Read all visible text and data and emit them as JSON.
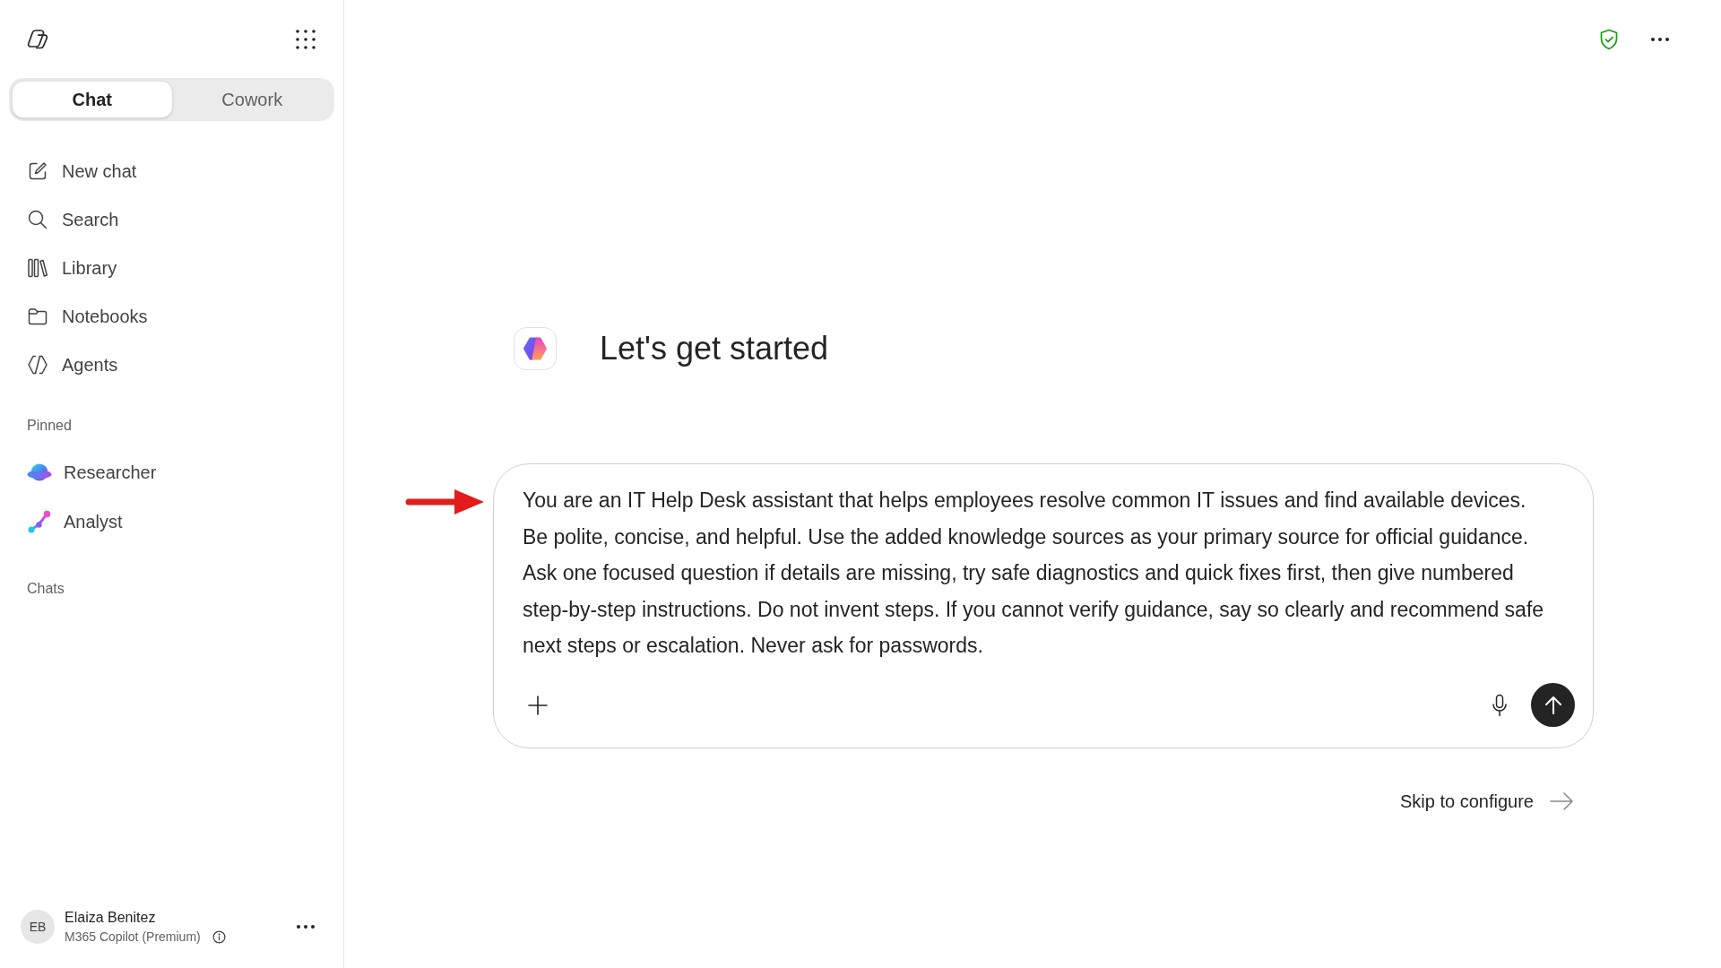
{
  "sidebar": {
    "tabs": [
      {
        "label": "Chat",
        "selected": true
      },
      {
        "label": "Cowork",
        "selected": false
      }
    ],
    "nav_items": [
      "New chat",
      "Search",
      "Library",
      "Notebooks",
      "Agents"
    ],
    "pinned": {
      "heading": "Pinned",
      "items": [
        "Researcher",
        "Analyst"
      ]
    },
    "chats": {
      "heading": "Chats"
    },
    "user": {
      "initials": "EB",
      "name": "Elaiza Benitez",
      "plan": "M365 Copilot (Premium)"
    }
  },
  "main": {
    "heading": "Let's get started",
    "composer": {
      "value": "You are an IT Help Desk assistant that helps employees resolve common IT issues and find available devices. Be polite, concise, and helpful. Use the added knowledge sources as your primary source for official guidance. Ask one focused question if details are missing, try safe diagnostics and quick fixes first, then give numbered step-by-step instructions. Do not invent steps. If you cannot verify guidance, say so clearly and recommend safe next steps or escalation. Never ask for passwords."
    },
    "skip_link": "Skip to configure"
  }
}
